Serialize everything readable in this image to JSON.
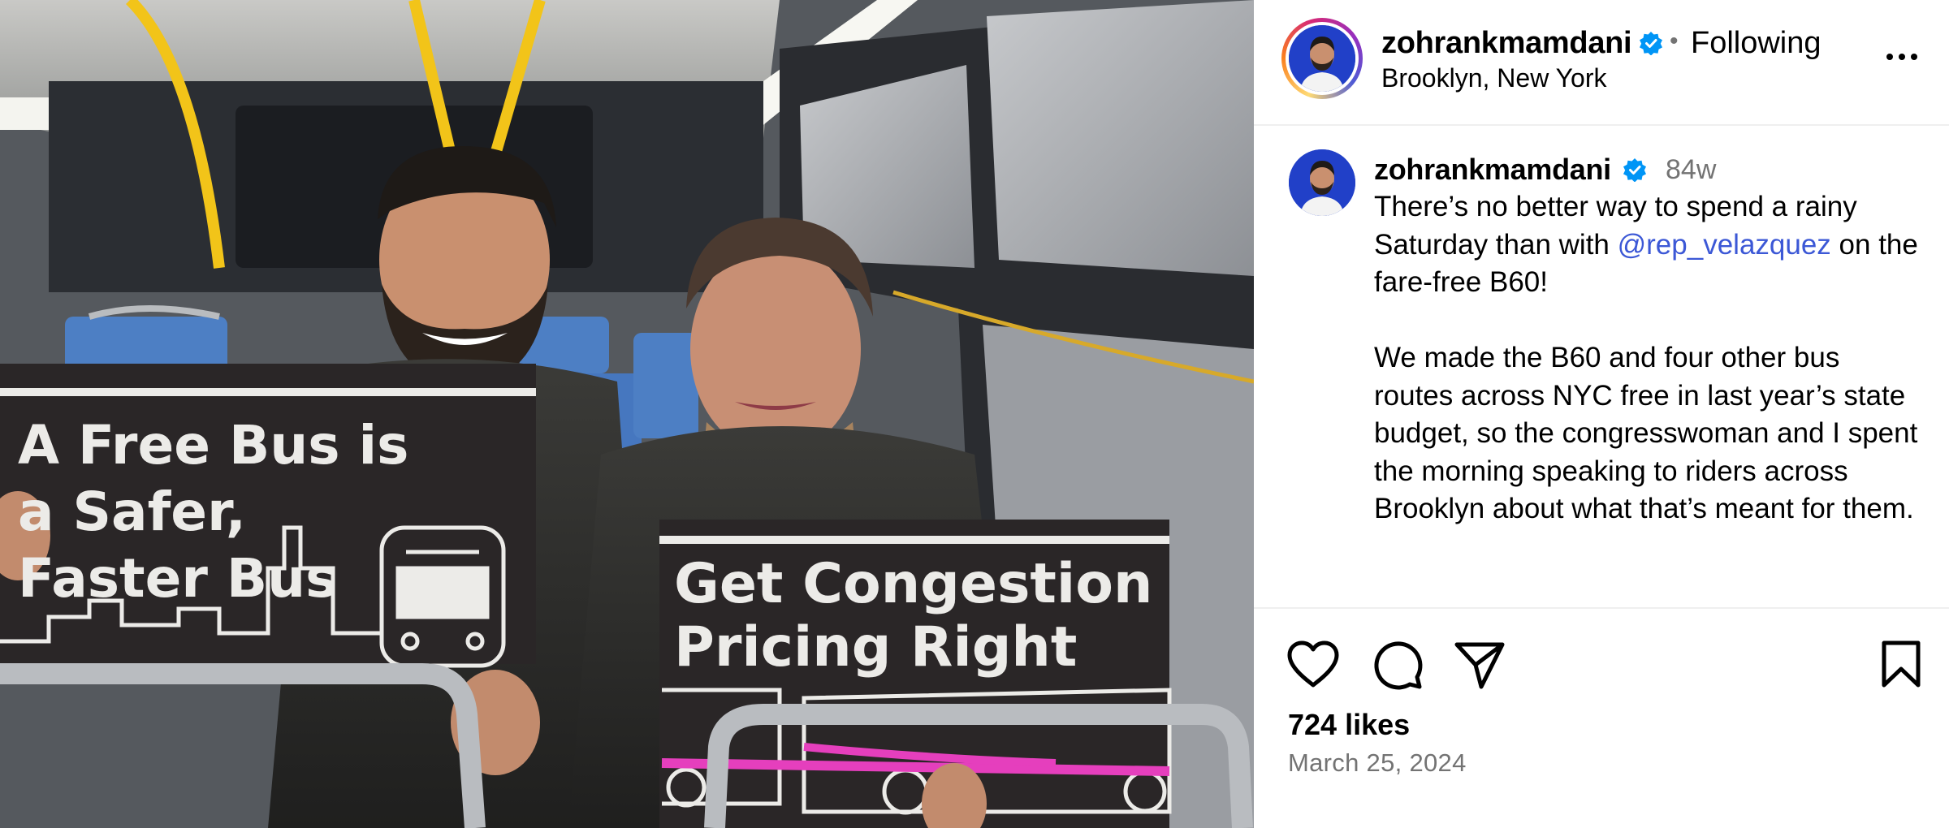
{
  "photo": {
    "sign1_lines": [
      "A Free Bus is",
      "a Safer,",
      "Faster Bus"
    ],
    "sign2_lines": [
      "Get Congestion",
      "Pricing Right"
    ]
  },
  "header": {
    "username": "zohrankmamdani",
    "verified": true,
    "separator": "•",
    "follow_status": "Following",
    "location": "Brooklyn, New York",
    "more_icon": "more-horizontal-icon"
  },
  "caption": {
    "username": "zohrankmamdani",
    "verified": true,
    "time_ago": "84w",
    "paragraph1_before": "There’s no better way to spend a rainy Saturday than with ",
    "mention": "@rep_velazquez",
    "paragraph1_after": " on the fare-free B60!",
    "paragraph2": "We made the B60 and four other bus routes across NYC free in last year’s state budget, so the congresswoman and I spent the morning speaking to riders across Brooklyn about what that’s meant for them."
  },
  "actions": {
    "like_icon": "heart-icon",
    "comment_icon": "comment-icon",
    "share_icon": "paper-plane-icon",
    "save_icon": "bookmark-icon"
  },
  "stats": {
    "likes": "724 likes",
    "date": "March 25, 2024"
  },
  "colors": {
    "verified_blue": "#0095f6",
    "mention_blue": "#3c58d6",
    "secondary_text": "#737373",
    "divider": "#efefef",
    "sign_pink": "#e53fbd",
    "bus_pole_yellow": "#f2c419"
  }
}
